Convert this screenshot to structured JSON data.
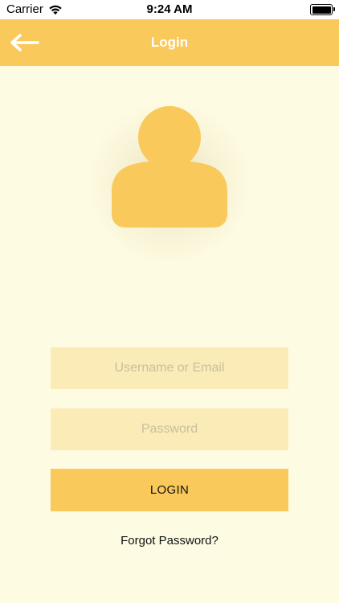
{
  "status_bar": {
    "carrier": "Carrier",
    "time": "9:24 AM"
  },
  "nav": {
    "title": "Login",
    "back_icon": "arrow-left-icon"
  },
  "avatar": {
    "icon": "user-avatar-icon",
    "color": "#F9C95B"
  },
  "form": {
    "username_placeholder": "Username or Email",
    "password_placeholder": "Password",
    "login_label": "LOGIN",
    "forgot_label": "Forgot Password?"
  },
  "colors": {
    "accent": "#F9C95B",
    "background": "#FEFBE3",
    "field": "#FBEBB6"
  }
}
